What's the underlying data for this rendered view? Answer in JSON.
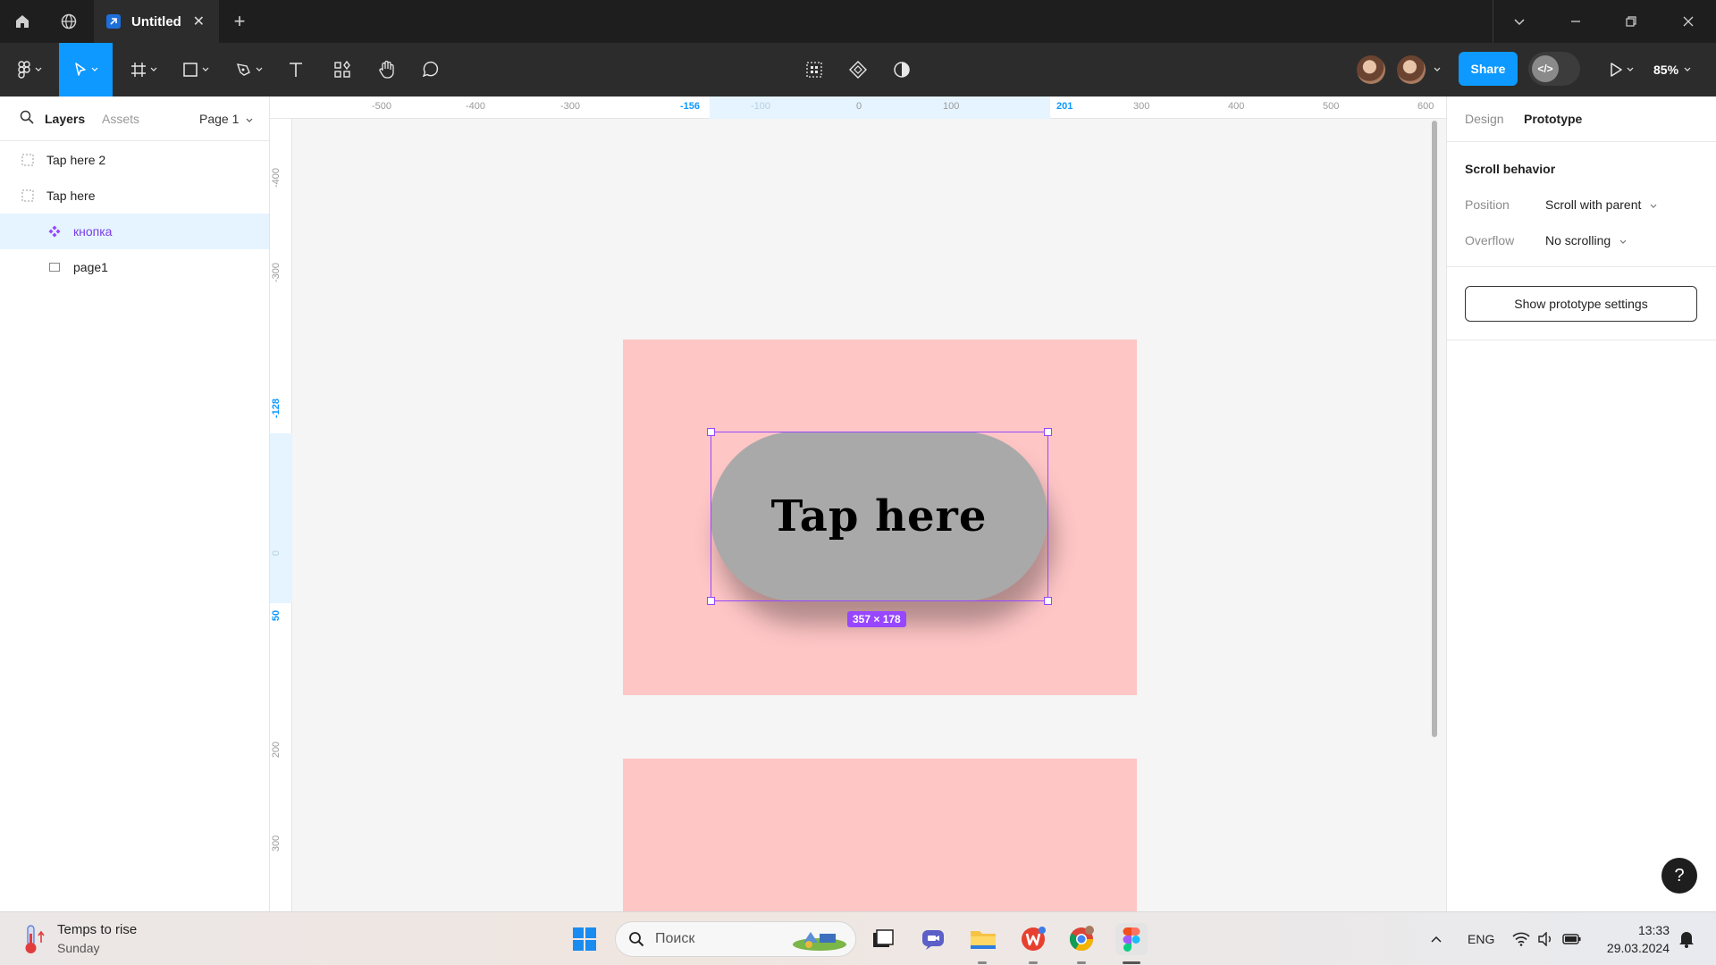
{
  "titlebar": {
    "tab_title": "Untitled",
    "tab_close": "✕",
    "new_tab": "+"
  },
  "toolbar": {
    "share_label": "Share",
    "zoom": "85%"
  },
  "left_panel": {
    "tabs": [
      "Layers",
      "Assets"
    ],
    "page_selector": "Page 1",
    "layers": [
      {
        "name": "Tap here 2",
        "icon": "dashed-frame-icon",
        "selected": false
      },
      {
        "name": "Tap here",
        "icon": "dashed-frame-icon",
        "selected": false
      },
      {
        "name": "кнопка",
        "icon": "component-icon",
        "selected": true
      },
      {
        "name": "page1",
        "icon": "frame-icon",
        "selected": false
      }
    ]
  },
  "rulers": {
    "top": [
      "-500",
      "-400",
      "-300",
      "-156",
      "-100",
      "0",
      "100",
      "201",
      "300",
      "400",
      "500",
      "600"
    ],
    "left": [
      "-400",
      "-300",
      "-128",
      "0",
      "50",
      "200",
      "300"
    ]
  },
  "canvas": {
    "button_text": "Tap here",
    "selection_size": "357 × 178",
    "colors": {
      "frame": "#ffc6c6",
      "button": "#a9a9a9",
      "selection": "#9747ff"
    }
  },
  "right_panel": {
    "tabs": [
      "Design",
      "Prototype"
    ],
    "section_title": "Scroll behavior",
    "position_label": "Position",
    "position_value": "Scroll with parent",
    "overflow_label": "Overflow",
    "overflow_value": "No scrolling",
    "prototype_settings_button": "Show prototype settings",
    "help": "?"
  },
  "taskbar": {
    "weather_title": "Temps to rise",
    "weather_sub": "Sunday",
    "search_placeholder": "Поиск",
    "language": "ENG",
    "time": "13:33",
    "date": "29.03.2024"
  }
}
